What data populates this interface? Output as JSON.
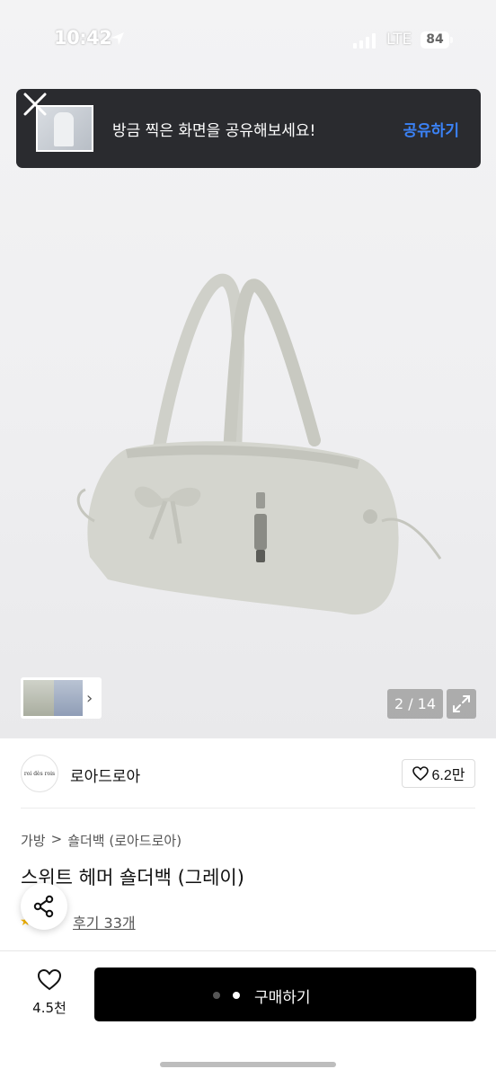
{
  "status_bar": {
    "time": "10:42",
    "network": "LTE",
    "battery": "84"
  },
  "toast": {
    "message": "방금 찍은 화면을 공유해보세요!",
    "action": "공유하기"
  },
  "gallery": {
    "counter": "2 / 14",
    "thumb_more": "›"
  },
  "brand": {
    "logo_text": "roi dès rois",
    "name": "로아드로아",
    "likes": "6.2만"
  },
  "breadcrumb": {
    "category": "가방",
    "separator": ">",
    "subcategory": "숄더백 (로아드로아)"
  },
  "product": {
    "title": "스위트 헤머 숄더백 (그레이)",
    "reviews": "후기 33개",
    "rating_stars": "★"
  },
  "bottom_bar": {
    "wish_count": "4.5천",
    "buy_label": "구매하기"
  },
  "colors": {
    "toast_bg": "#2a2b2f",
    "toast_action": "#3b82f6",
    "buy_bg": "#000000",
    "bag": "#d3d4cd"
  }
}
